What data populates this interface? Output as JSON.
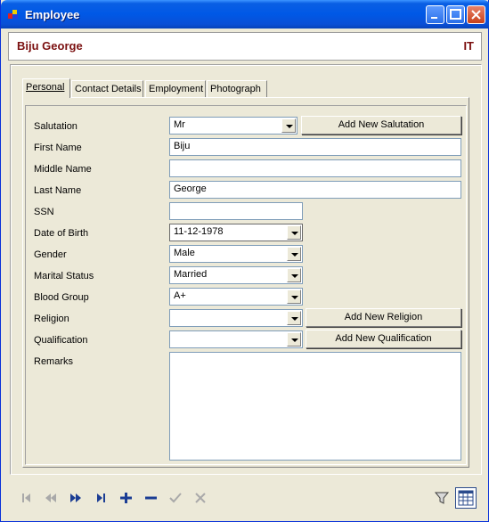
{
  "window": {
    "title": "Employee"
  },
  "header": {
    "name": "Biju George",
    "dept": "IT"
  },
  "tabs": [
    {
      "label": "Personal"
    },
    {
      "label": "Contact Details"
    },
    {
      "label": "Employment"
    },
    {
      "label": "Photograph"
    }
  ],
  "form": {
    "salutation": {
      "label": "Salutation",
      "value": "Mr",
      "button": "Add New Salutation"
    },
    "first_name": {
      "label": "First Name",
      "value": "Biju"
    },
    "middle_name": {
      "label": "Middle Name",
      "value": ""
    },
    "last_name": {
      "label": "Last Name",
      "value": "George"
    },
    "ssn": {
      "label": "SSN",
      "value": ""
    },
    "dob": {
      "label": "Date of Birth",
      "value": "11-12-1978"
    },
    "gender": {
      "label": "Gender",
      "value": "Male"
    },
    "marital": {
      "label": "Marital Status",
      "value": "Married"
    },
    "blood": {
      "label": "Blood Group",
      "value": "A+"
    },
    "religion": {
      "label": "Religion",
      "value": "",
      "button": "Add New Religion"
    },
    "qualification": {
      "label": "Qualification",
      "value": "",
      "button": "Add New Qualification"
    },
    "remarks": {
      "label": "Remarks",
      "value": ""
    }
  },
  "toolbar": {
    "first": "⏮",
    "prev": "⏪",
    "next": "⏩",
    "last": "⏭",
    "add": "+",
    "remove": "−",
    "save": "✓",
    "cancel": "✕"
  },
  "icons": {
    "app": "employee-app-icon",
    "filter": "filter-icon",
    "grid": "grid-view-icon"
  },
  "colors": {
    "accent": "#7b1010",
    "titlebar": "#0058e6"
  }
}
